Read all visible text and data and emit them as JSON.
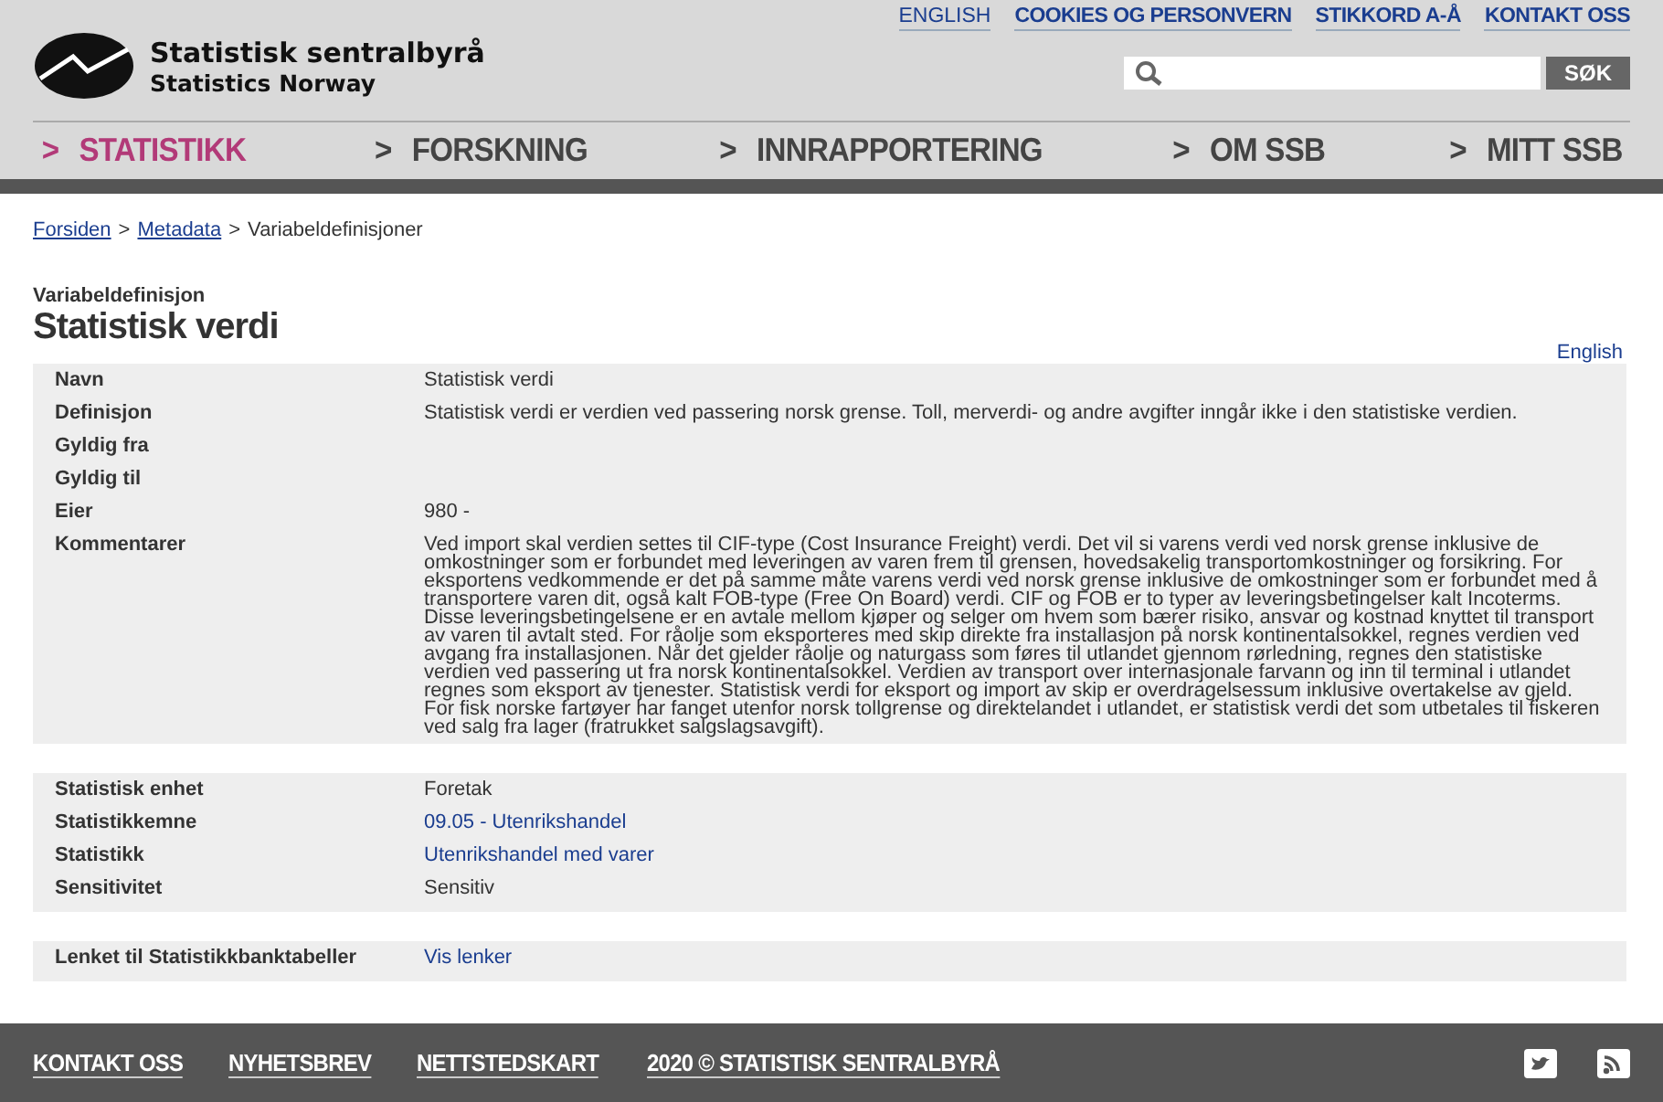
{
  "header": {
    "logo": {
      "name": "Statistisk sentralbyrå",
      "subtitle": "Statistics Norway"
    },
    "top_links": [
      {
        "label": "ENGLISH",
        "kind": "plain"
      },
      {
        "label": "COOKIES OG PERSONVERN",
        "kind": "bold"
      },
      {
        "label": "STIKKORD A-Å",
        "kind": "bold"
      },
      {
        "label": "KONTAKT OSS",
        "kind": "bold"
      }
    ],
    "search": {
      "button": "SØK"
    },
    "nav": [
      {
        "arrow": ">",
        "label": "STATISTIKK",
        "selected": true
      },
      {
        "arrow": ">",
        "label": "FORSKNING",
        "selected": false
      },
      {
        "arrow": ">",
        "label": "INNRAPPORTERING",
        "selected": false
      },
      {
        "arrow": ">",
        "label": "OM SSB",
        "selected": false
      },
      {
        "arrow": ">",
        "label": "MITT SSB",
        "selected": false
      }
    ]
  },
  "breadcrumb": [
    {
      "label": "Forsiden",
      "kind": "link",
      "separator": ">"
    },
    {
      "label": "Metadata",
      "kind": "link",
      "separator": ">"
    },
    {
      "label": "Variabeldefinisjoner",
      "kind": "current"
    }
  ],
  "page": {
    "kicker": "Variabeldefinisjon",
    "title": "Statistisk verdi",
    "language_link": "English"
  },
  "tables": [
    {
      "rows": [
        {
          "label": "Navn",
          "value": "Statistisk verdi",
          "kind": "text"
        },
        {
          "label": "Definisjon",
          "value": "Statistisk verdi er verdien ved passering norsk grense. Toll, merverdi- og andre avgifter inngår ikke i den statistiske verdien.",
          "kind": "text"
        },
        {
          "label": "Gyldig fra"
        },
        {
          "label": "Gyldig til"
        },
        {
          "label": "Eier",
          "value": "980 -",
          "kind": "text"
        },
        {
          "label": "Kommentarer",
          "value": "Ved import skal verdien settes til CIF-type (Cost Insurance Freight) verdi. Det vil si varens verdi ved norsk grense inklusive de omkostninger som er forbundet med leveringen av varen frem til grensen, hovedsakelig transportomkostninger og forsikring. For eksportens vedkommende er det på samme måte varens verdi ved norsk grense inklusive de omkostninger som er forbundet med å transportere varen dit, også kalt FOB-type (Free On Board) verdi. CIF og FOB er to typer av leveringsbetingelser kalt Incoterms. Disse leveringsbetingelsene er en avtale mellom kjøper og selger om hvem som bærer risiko, ansvar og kostnad knyttet til transport av varen til avtalt sted. For råolje som eksporteres med skip direkte fra installasjon på norsk kontinentalsokkel, regnes verdien ved avgang fra installasjonen. Når det gjelder råolje og naturgass som føres til utlandet gjennom rørledning, regnes den statistiske verdien ved passering ut fra norsk kontinentalsokkel. Verdien av transport over internasjonale farvann og inn til terminal i utlandet regnes som eksport av tjenester. Statistisk verdi for eksport og import av skip er overdragelsessum inklusive overtakelse av gjeld. For fisk norske fartøyer har fanget utenfor norsk tollgrense og direktelandet i utlandet, er statistisk verdi det som utbetales til fiskeren ved salg fra lager (fratrukket salgslagsavgift).",
          "kind": "text"
        }
      ]
    },
    {
      "rows": [
        {
          "label": "Statistisk enhet",
          "value": "Foretak",
          "kind": "text"
        },
        {
          "label": "Statistikkemne",
          "value": "09.05 - Utenrikshandel",
          "kind": "link"
        },
        {
          "label": "Statistikk",
          "value": "Utenrikshandel med varer",
          "kind": "link"
        },
        {
          "label": "Sensitivitet",
          "value": "Sensitiv",
          "kind": "text"
        }
      ]
    },
    {
      "rows": [
        {
          "label": "Lenket til Statistikkbanktabeller",
          "value": "Vis lenker",
          "kind": "link"
        }
      ]
    }
  ],
  "footer": {
    "links": [
      "KONTAKT OSS",
      "NYHETSBREV",
      "NETTSTEDSKART",
      "2020 © STATISTISK SENTRALBYRÅ"
    ]
  }
}
